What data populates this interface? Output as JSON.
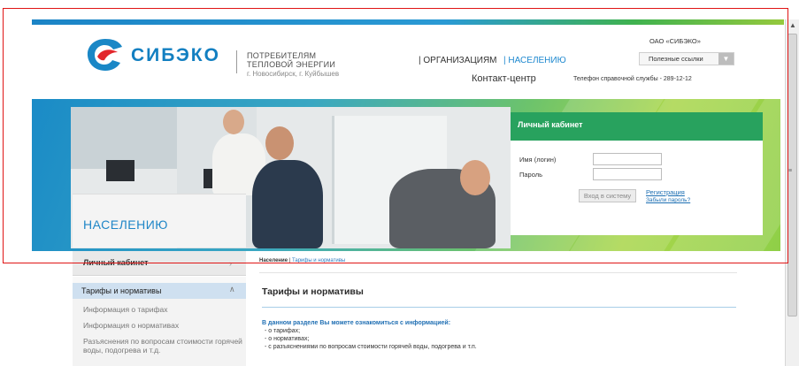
{
  "header": {
    "logo_text": "СИБЭКО",
    "tagline": [
      "ПОТРЕБИТЕЛЯМ",
      "ТЕПЛОВОЙ ЭНЕРГИИ"
    ],
    "tagline_city": "г. Новосибирск, г. Куйбышев",
    "nav_org": "| ОРГАНИЗАЦИЯМ",
    "nav_population": "| НАСЕЛЕНИЮ",
    "contact_center": "Контакт-центр",
    "company": "ОАО «СИБЭКО»",
    "useful_links": "Полезные ссылки",
    "phone": "Телефон справочной службы - 289-12-12"
  },
  "banner": {
    "section_title": "НАСЕЛЕНИЮ"
  },
  "login": {
    "title": "Личный кабинет",
    "login_label": "Имя (логин)",
    "password_label": "Пароль",
    "submit": "Вход в систему",
    "register": "Регистрация",
    "forgot": "Забыли пароль?"
  },
  "sidebar": {
    "cabinet": "Личный кабинет",
    "cabinet_arrow": "›",
    "tariffs": "Тарифы и нормативы",
    "tariffs_arrow": "∧",
    "items": [
      "Информация о тарифах",
      "Информация о нормативах",
      "Разъяснения по вопросам стоимости горячей воды, подогрева и т.д."
    ]
  },
  "content": {
    "breadcrumb_home": "Население",
    "breadcrumb_sep": "|",
    "breadcrumb_current": "Тарифы и нормативы",
    "title": "Тарифы и нормативы",
    "intro": "В данном разделе Вы можете ознакомиться с информацией:",
    "bullets": [
      "- о тарифах;",
      "- о нормативах;",
      "- с разъяснениями по вопросам стоимости горячей воды, подогрева и т.п."
    ]
  },
  "icons": {
    "logo": "sibeco-logo-icon",
    "dropdown": "chevron-down-icon"
  },
  "colors": {
    "brand_blue": "#127fc1",
    "login_green": "#28a25e",
    "highlight_outline": "#e01515"
  }
}
